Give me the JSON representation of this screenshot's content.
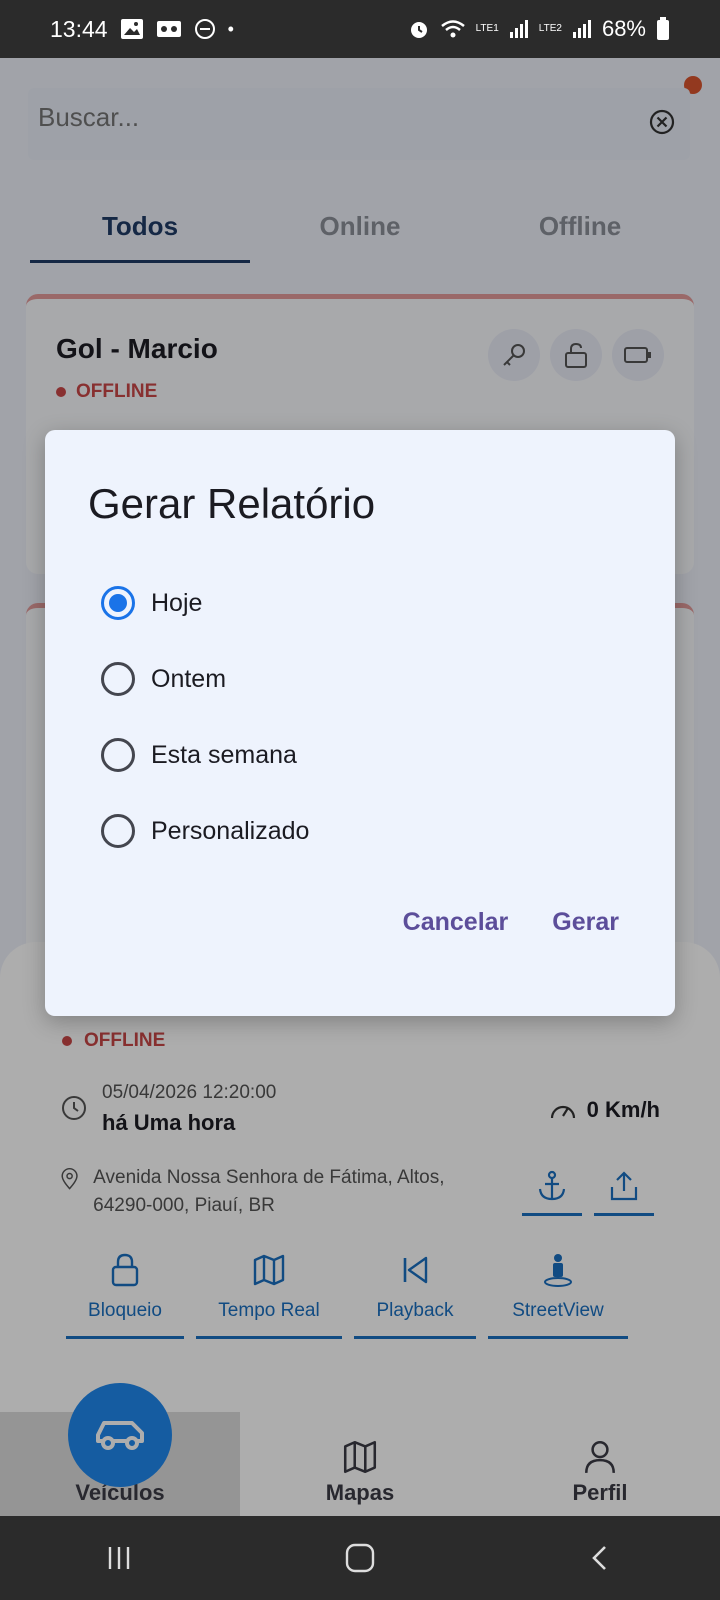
{
  "status_bar": {
    "time": "13:44",
    "lte1": "LTE1",
    "lte2": "LTE2",
    "battery": "68%"
  },
  "search": {
    "placeholder": "Buscar..."
  },
  "tabs": [
    {
      "label": "Todos",
      "active": true
    },
    {
      "label": "Online",
      "active": false
    },
    {
      "label": "Offline",
      "active": false
    }
  ],
  "card1": {
    "title": "Gol - Marcio",
    "status": "OFFLINE"
  },
  "sheet": {
    "status": "OFFLINE",
    "date": "05/04/2026 12:20:00",
    "ago": "há Uma hora",
    "speed": "0 Km/h",
    "address": "Avenida Nossa Senhora de Fátima, Altos, 64290-000, Piauí, BR",
    "actions": [
      "Bloqueio",
      "Tempo Real",
      "Playback",
      "StreetView"
    ]
  },
  "dialog": {
    "title": "Gerar Relatório",
    "options": [
      {
        "label": "Hoje",
        "selected": true
      },
      {
        "label": "Ontem",
        "selected": false
      },
      {
        "label": "Esta semana",
        "selected": false
      },
      {
        "label": "Personalizado",
        "selected": false
      }
    ],
    "cancel": "Cancelar",
    "confirm": "Gerar"
  },
  "bottom_nav": {
    "items": [
      {
        "label": "Veículos",
        "icon": "car-icon",
        "active": true
      },
      {
        "label": "Mapas",
        "icon": "map-icon",
        "active": false
      },
      {
        "label": "Perfil",
        "icon": "user-icon",
        "active": false
      }
    ]
  },
  "colors": {
    "primary": "#1f88ee",
    "accent_blue": "#1a6fc0",
    "offline_red": "#c94848",
    "dialog_button": "#5c4e9a"
  }
}
